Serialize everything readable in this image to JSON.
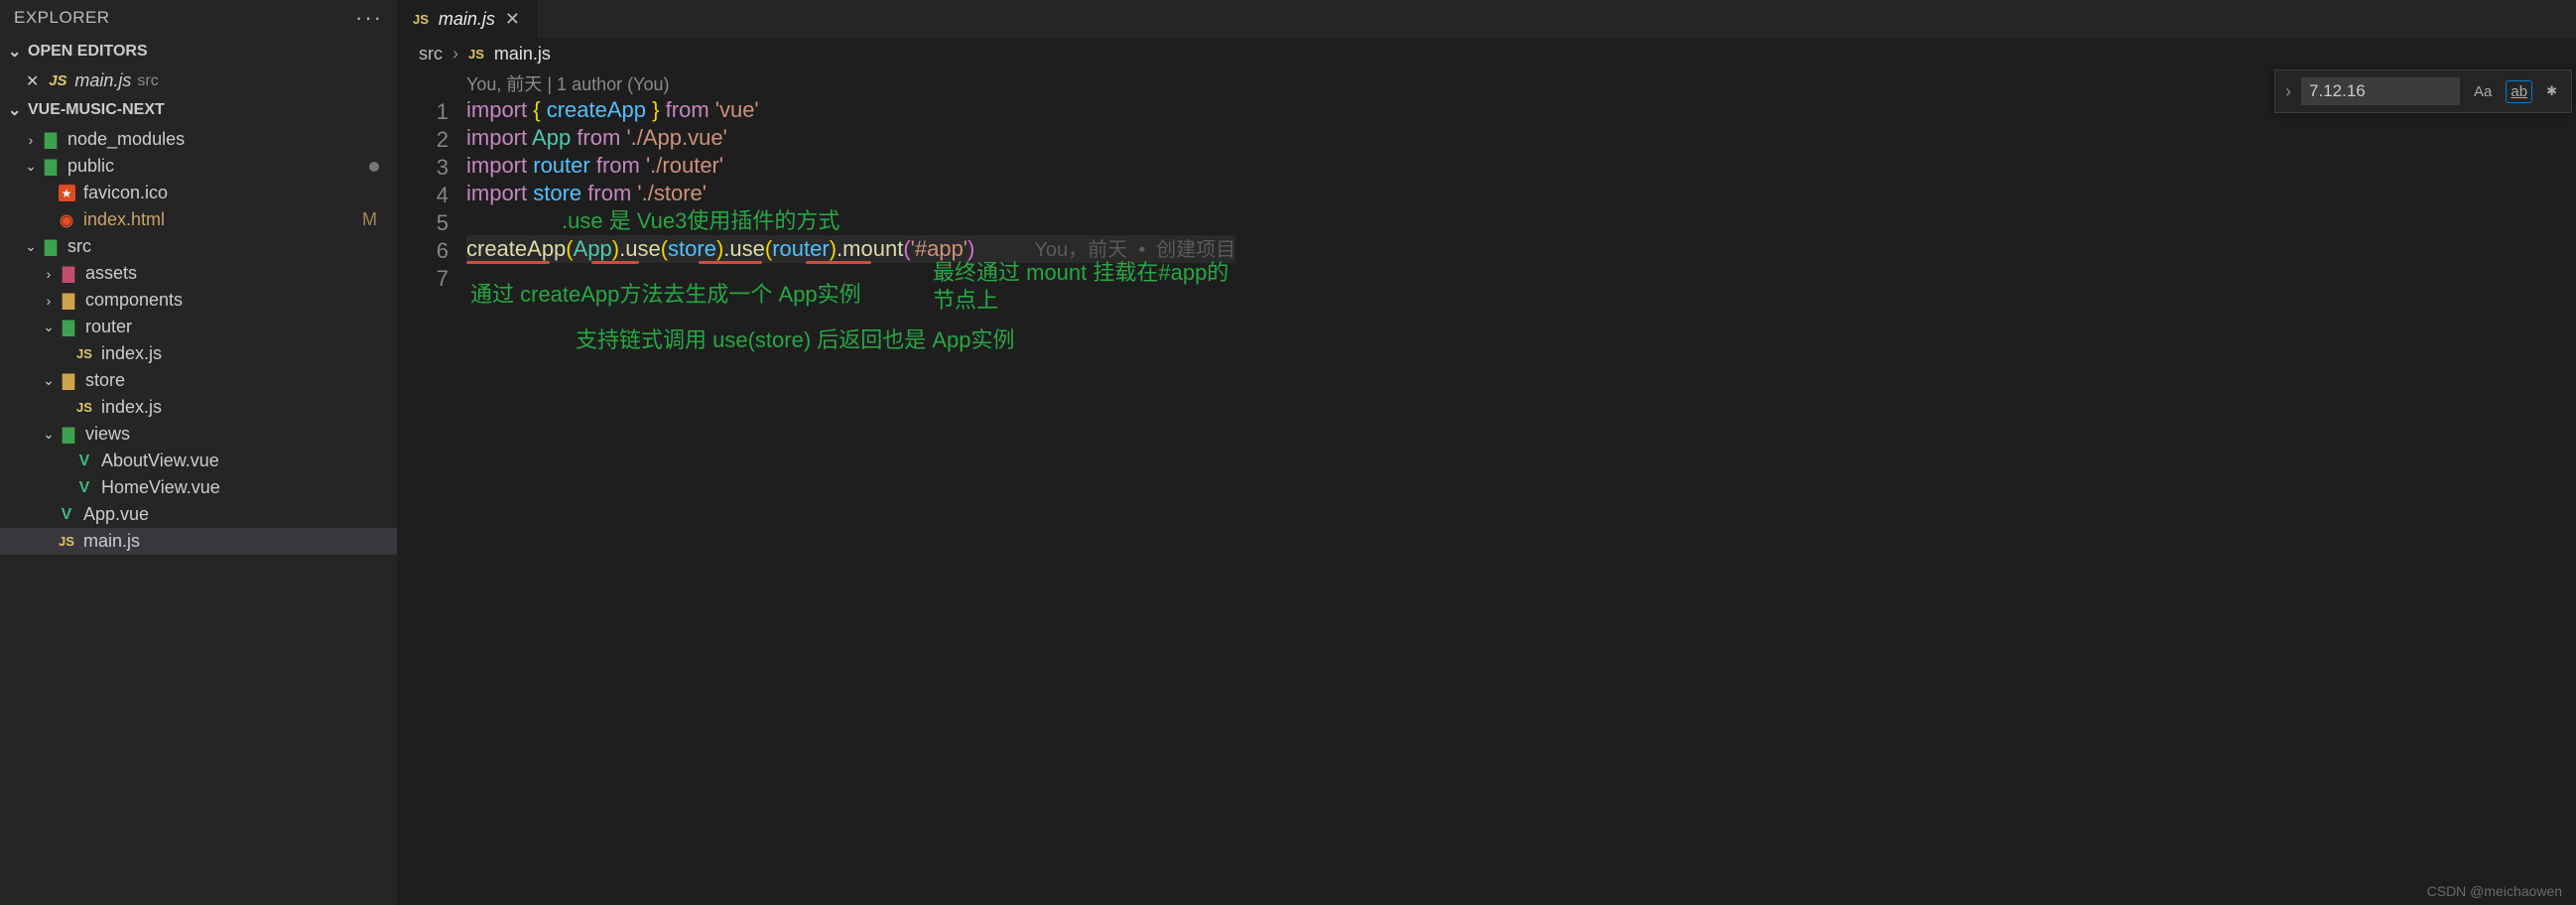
{
  "explorer": {
    "title": "EXPLORER"
  },
  "openEditors": {
    "title": "OPEN EDITORS",
    "file": "main.js",
    "path": "src"
  },
  "project": {
    "name": "VUE-MUSIC-NEXT",
    "tree": {
      "node_modules": "node_modules",
      "public": "public",
      "favicon": "favicon.ico",
      "indexhtml": "index.html",
      "indexhtml_badge": "M",
      "src": "src",
      "assets": "assets",
      "components": "components",
      "router": "router",
      "router_index": "index.js",
      "store": "store",
      "store_index": "index.js",
      "views": "views",
      "aboutview": "AboutView.vue",
      "homeview": "HomeView.vue",
      "appvue": "App.vue",
      "mainjs": "main.js"
    }
  },
  "tab": {
    "filename": "main.js"
  },
  "crumbs": {
    "src": "src",
    "mainjs": "main.js"
  },
  "codelens": "You, 前天 | 1 author (You)",
  "blame": "You，前天  •  创建项目",
  "code": {
    "l1": {
      "import": "import",
      "brace_o": "{",
      "createApp": "createApp",
      "brace_c": "}",
      "from": "from",
      "vue": "'vue'"
    },
    "l2": {
      "import": "import",
      "App": "App",
      "from": "from",
      "path": "'./App.vue'"
    },
    "l3": {
      "import": "import",
      "router": "router",
      "from": "from",
      "path": "'./router'"
    },
    "l4": {
      "import": "import",
      "store": "store",
      "from": "from",
      "path": "'./store'"
    },
    "l6": {
      "createApp": "createApp",
      "App": "App",
      "use1": "use",
      "store": "store",
      "use2": "use",
      "router": "router",
      "mount": "mount",
      "target": "'#app'"
    }
  },
  "linenums": {
    "1": "1",
    "2": "2",
    "3": "3",
    "4": "4",
    "5": "5",
    "6": "6",
    "7": "7"
  },
  "annotations": {
    "a1": ".use 是 Vue3使用插件的方式",
    "a2": "通过 createApp方法去生成一个 App实例",
    "a3": "支持链式调用 use(store) 后返回也是 App实例",
    "a4": "最终通过 mount 挂载在#app的节点上"
  },
  "find": {
    "value": "7.12.16",
    "Aa": "Aa",
    "ab": "ab",
    "star": "✱"
  },
  "watermark": "CSDN @meichaowen"
}
